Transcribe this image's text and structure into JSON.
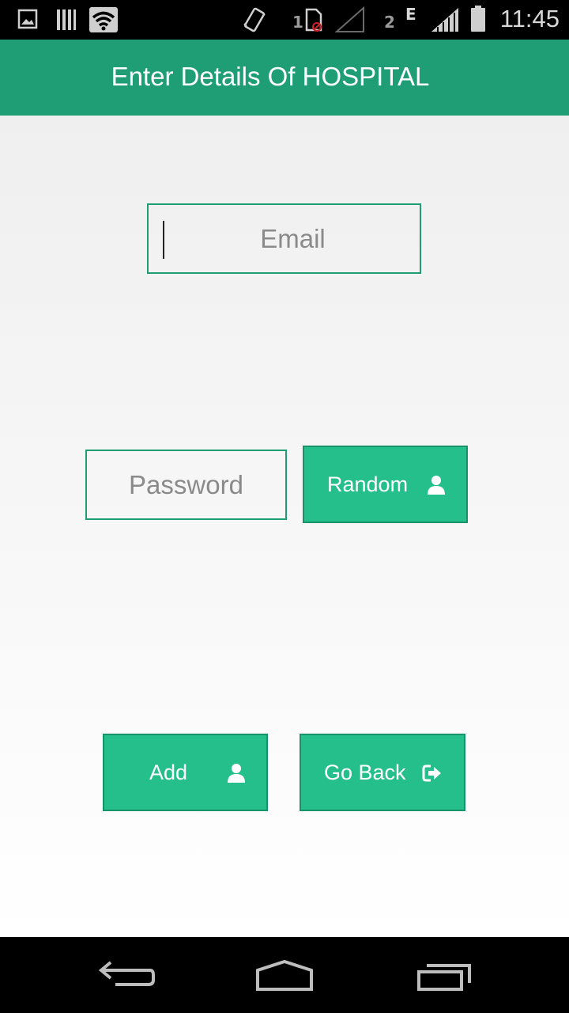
{
  "status_bar": {
    "time": "11:45",
    "sim1": "1",
    "sim2": "2",
    "network_type": "E",
    "icons": [
      "image-icon",
      "barcode-icon",
      "wifi-icon",
      "vibrate-icon",
      "sim-card-icon",
      "signal-icon",
      "signal-icon",
      "battery-icon"
    ]
  },
  "app_bar": {
    "title": "Enter Details Of HOSPITAL"
  },
  "form": {
    "email_placeholder": "Email",
    "password_placeholder": "Password",
    "random_label": "Random",
    "add_label": "Add",
    "go_back_label": "Go Back"
  },
  "colors": {
    "app_bar": "#1f9e76",
    "button": "#25bf8b",
    "border": "#1f9e76"
  },
  "nav_bar": {
    "icons": [
      "back-icon",
      "home-icon",
      "recents-icon"
    ]
  }
}
